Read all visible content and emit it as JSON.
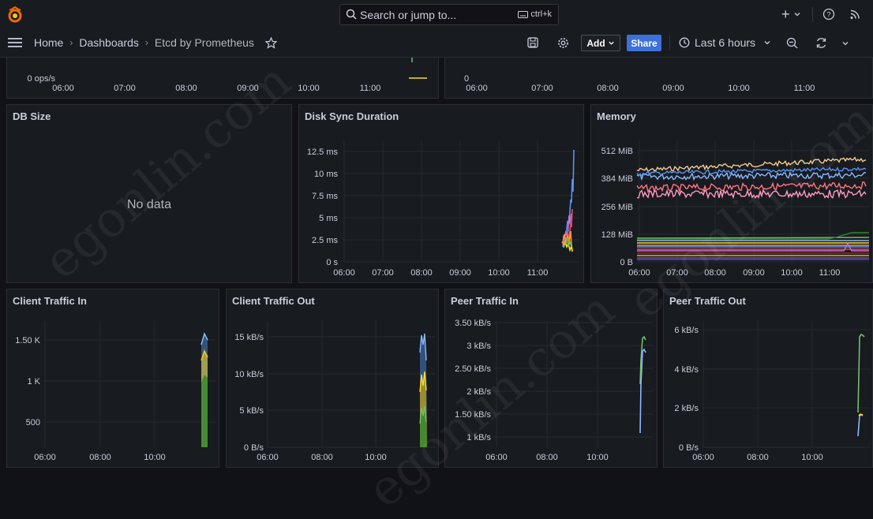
{
  "topbar": {
    "search_placeholder": "Search or jump to...",
    "search_shortcut": "ctrl+k",
    "logo_color": "#f46800",
    "icons": [
      "grafana-logo-icon",
      "search-icon",
      "keyboard-icon",
      "plus-icon",
      "chevron-down-icon",
      "help-icon",
      "rss-icon"
    ]
  },
  "breadcrumb": {
    "home": "Home",
    "dashboards": "Dashboards",
    "current": "Etcd by Prometheus"
  },
  "toolbar": {
    "add_label": "Add",
    "share_label": "Share",
    "time_range": "Last 6 hours",
    "share_color": "#3d71d9"
  },
  "watermark": "egonlin.com",
  "top_partial_left": {
    "y_tick": "0 ops/s",
    "x_ticks": [
      "06:00",
      "07:00",
      "08:00",
      "09:00",
      "10:00",
      "11:00"
    ]
  },
  "top_partial_right": {
    "y_tick": "0",
    "x_ticks": [
      "06:00",
      "07:00",
      "08:00",
      "09:00",
      "10:00",
      "11:00"
    ]
  },
  "panels": {
    "db_size": {
      "title": "DB Size",
      "no_data": "No data"
    },
    "disk_sync": {
      "title": "Disk Sync Duration",
      "y_ticks": [
        "12.5 ms",
        "10 ms",
        "7.5 ms",
        "5 ms",
        "2.5 ms",
        "0 s"
      ],
      "x_ticks": [
        "06:00",
        "07:00",
        "08:00",
        "09:00",
        "10:00",
        "11:00"
      ]
    },
    "memory": {
      "title": "Memory",
      "y_ticks": [
        "512 MiB",
        "384 MiB",
        "256 MiB",
        "128 MiB",
        "0 B"
      ],
      "x_ticks": [
        "06:00",
        "07:00",
        "08:00",
        "09:00",
        "10:00",
        "11:00"
      ]
    },
    "client_in": {
      "title": "Client Traffic In",
      "y_ticks": [
        "1.50 K",
        "1 K",
        "500"
      ],
      "x_ticks": [
        "06:00",
        "08:00",
        "10:00"
      ]
    },
    "client_out": {
      "title": "Client Traffic Out",
      "y_ticks": [
        "15 kB/s",
        "10 kB/s",
        "5 kB/s",
        "0 B/s"
      ],
      "x_ticks": [
        "06:00",
        "08:00",
        "10:00"
      ]
    },
    "peer_in": {
      "title": "Peer Traffic In",
      "y_ticks": [
        "3.50 kB/s",
        "3 kB/s",
        "2.50 kB/s",
        "2 kB/s",
        "1.50 kB/s",
        "1 kB/s"
      ],
      "x_ticks": [
        "06:00",
        "08:00",
        "10:00"
      ]
    },
    "peer_out": {
      "title": "Peer Traffic Out",
      "y_ticks": [
        "6 kB/s",
        "4 kB/s",
        "2 kB/s",
        "0 B/s"
      ],
      "x_ticks": [
        "06:00",
        "08:00",
        "10:00"
      ]
    }
  },
  "series_colors": {
    "green": "#73bf69",
    "yellow": "#fade2a",
    "blue": "#5794f2",
    "orange": "#ff9830",
    "red": "#f2495c",
    "purple": "#b877d9",
    "lightblue": "#8ab8ff",
    "pink": "#ff99c5",
    "sand": "#f2cc8f"
  }
}
